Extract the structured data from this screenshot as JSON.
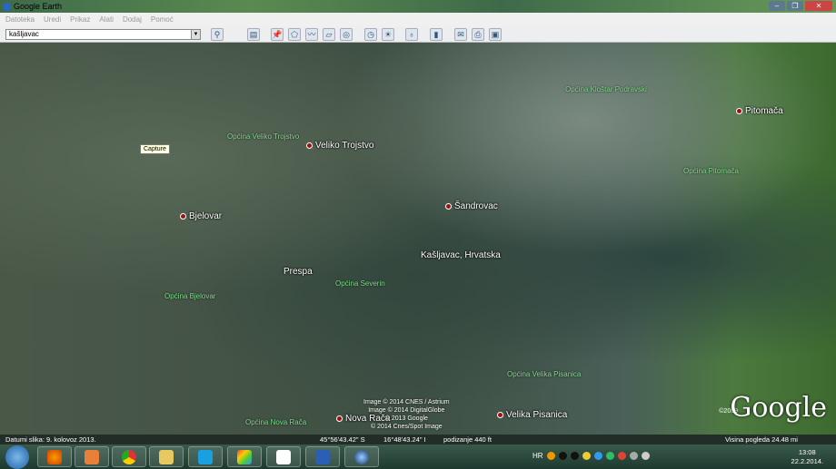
{
  "window": {
    "title": "Google Earth"
  },
  "menu": [
    "Datoteka",
    "Uredi",
    "Prikaz",
    "Alati",
    "Dodaj",
    "Pomoć"
  ],
  "search": {
    "value": "kašljavac"
  },
  "toolbar_icons": [
    "search-icon",
    "sidebar-icon",
    "placemark-icon",
    "polygon-icon",
    "path-icon",
    "overlay-icon",
    "tour-icon",
    "historical-imagery-icon",
    "sun-icon",
    "planets-icon",
    "ruler-icon",
    "email-icon",
    "print-icon",
    "save-image-icon"
  ],
  "map": {
    "tooltip": "Capture",
    "places": [
      "Veliko Trojstvo",
      "Bjelovar",
      "Šandrovac",
      "Prespa",
      "Kašljavac, Hrvatska",
      "Pitomača",
      "Nova Rača",
      "Velika Pisanica"
    ],
    "regions": [
      "Općina Veliko Trojstvo",
      "Općina Kloštar Podravski",
      "Općina Pitomača",
      "Općina Bjelovar",
      "Općina Severin",
      "Općina Velika Pisanica",
      "Općina Nova Rača"
    ],
    "credits": [
      "Image © 2014 CNES / Astrium",
      "Image © 2014 DigitalGlobe",
      "© 2013 Google",
      "© 2014 Cnes/Spot Image"
    ],
    "logo": "Google",
    "logo_year": "©2009"
  },
  "status": {
    "date": "Datumi slika: 9. kolovoz 2013.",
    "lat": "45°56'43.42\" S",
    "lon": "16°48'43.24\" I",
    "elev": "podizanje   440 ft",
    "eye": "Visina pogleda   24.48 mi"
  },
  "taskbar": {
    "apps": [
      "firefox",
      "media-player",
      "chrome",
      "file-explorer",
      "skype",
      "paint",
      "solitaire",
      "word",
      "google-earth"
    ],
    "lang": "HR",
    "time": "13:08",
    "date": "22.2.2014."
  }
}
